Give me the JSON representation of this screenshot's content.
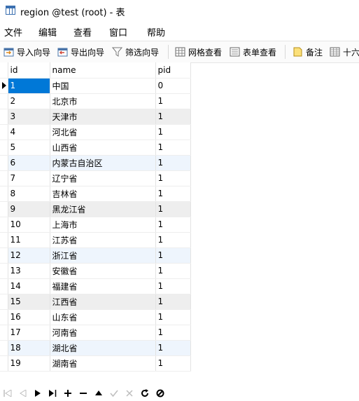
{
  "window": {
    "title": "region @test (root) - 表"
  },
  "menu": [
    {
      "label": "文件"
    },
    {
      "label": "编辑"
    },
    {
      "label": "查看"
    },
    {
      "label": "窗口"
    },
    {
      "label": "帮助"
    }
  ],
  "toolbar": {
    "import": "导入向导",
    "export": "导出向导",
    "filter": "筛选向导",
    "grid_view": "网格查看",
    "form_view": "表单查看",
    "memo": "备注",
    "hex": "十六"
  },
  "table": {
    "columns": [
      "id",
      "name",
      "pid"
    ],
    "rows": [
      [
        "1",
        "中国",
        "0"
      ],
      [
        "2",
        "北京市",
        "1"
      ],
      [
        "3",
        "天津市",
        "1"
      ],
      [
        "4",
        "河北省",
        "1"
      ],
      [
        "5",
        "山西省",
        "1"
      ],
      [
        "6",
        "内蒙古自治区",
        "1"
      ],
      [
        "7",
        "辽宁省",
        "1"
      ],
      [
        "8",
        "吉林省",
        "1"
      ],
      [
        "9",
        "黑龙江省",
        "1"
      ],
      [
        "10",
        "上海市",
        "1"
      ],
      [
        "11",
        "江苏省",
        "1"
      ],
      [
        "12",
        "浙江省",
        "1"
      ],
      [
        "13",
        "安徽省",
        "1"
      ],
      [
        "14",
        "福建省",
        "1"
      ],
      [
        "15",
        "江西省",
        "1"
      ],
      [
        "16",
        "山东省",
        "1"
      ],
      [
        "17",
        "河南省",
        "1"
      ],
      [
        "18",
        "湖北省",
        "1"
      ],
      [
        "19",
        "湖南省",
        "1"
      ]
    ]
  },
  "navigation": {
    "icons": [
      "first-record-icon",
      "previous-record-icon",
      "next-record-icon",
      "last-record-icon",
      "add-record-icon",
      "delete-record-icon",
      "move-up-icon",
      "apply-icon",
      "discard-icon",
      "refresh-icon",
      "stop-icon"
    ]
  }
}
